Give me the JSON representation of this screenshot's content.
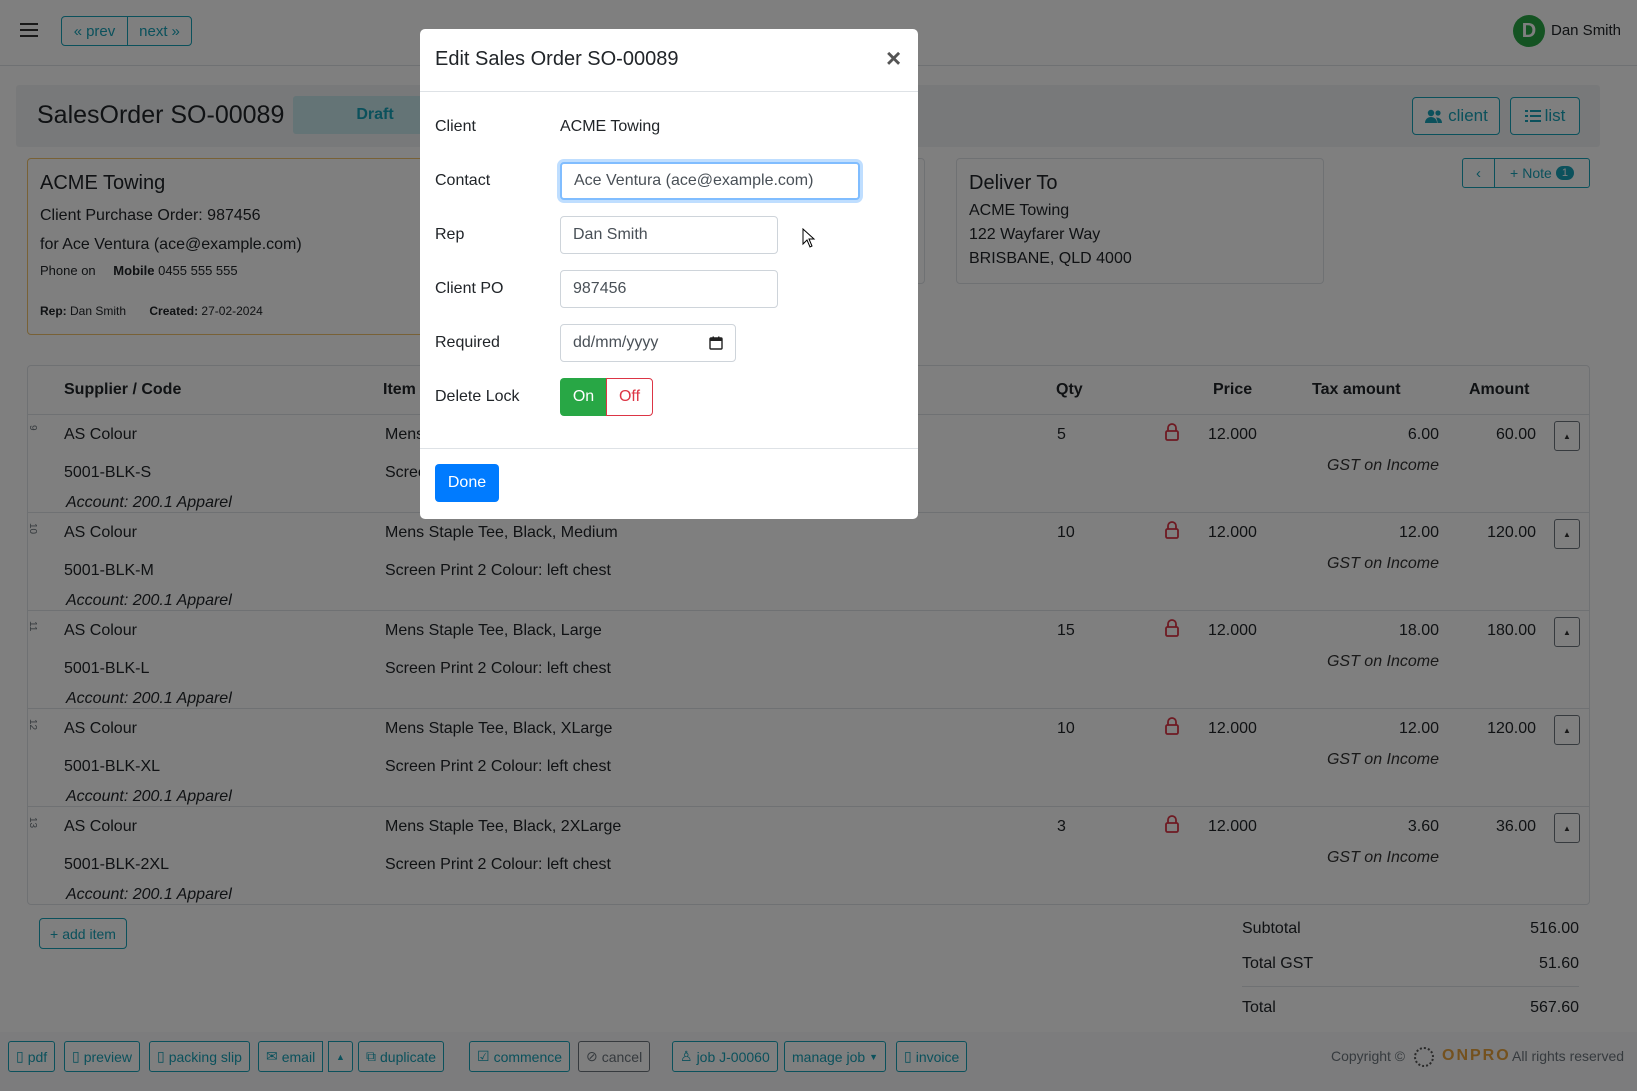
{
  "topbar": {
    "prev_label": "prev",
    "next_label": "next",
    "user_initial": "D",
    "user_name": "Dan Smith"
  },
  "header": {
    "title": "SalesOrder SO-00089",
    "status": "Draft",
    "client_button": "client",
    "list_button": "list"
  },
  "client_card": {
    "name": "ACME Towing",
    "po_line": "Client Purchase Order: 987456",
    "for_line": "for Ace Ventura (ace@example.com)",
    "phone_label": "Phone on",
    "mobile_label": "Mobile",
    "mobile_value": "0455 555 555",
    "rep_label": "Rep:",
    "rep_value": "Dan Smith",
    "created_label": "Created:",
    "created_value": "27-02-2024"
  },
  "deliver_card": {
    "title": "Deliver To",
    "line1": "ACME Towing",
    "line2": "122 Wayfarer Way",
    "line3": "BRISBANE, QLD 4000"
  },
  "note_button": {
    "label": "Note",
    "count": "1"
  },
  "table": {
    "headers": {
      "supplier": "Supplier / Code",
      "item": "Item",
      "qty": "Qty",
      "price": "Price",
      "tax": "Tax amount",
      "amount": "Amount"
    },
    "rows": [
      {
        "idx": "9",
        "supplier": "AS Colour",
        "code": "5001-BLK-S",
        "item": "Mens",
        "desc": "Scree",
        "account": "Account: 200.1 Apparel",
        "qty": "5",
        "price": "12.000",
        "tax": "6.00",
        "tax_note": "GST on Income",
        "amount": "60.00"
      },
      {
        "idx": "10",
        "supplier": "AS Colour",
        "code": "5001-BLK-M",
        "item": "Mens Staple Tee, Black, Medium",
        "desc": "Screen Print 2 Colour: left chest",
        "account": "Account: 200.1 Apparel",
        "qty": "10",
        "price": "12.000",
        "tax": "12.00",
        "tax_note": "GST on Income",
        "amount": "120.00"
      },
      {
        "idx": "11",
        "supplier": "AS Colour",
        "code": "5001-BLK-L",
        "item": "Mens Staple Tee, Black, Large",
        "desc": "Screen Print 2 Colour: left chest",
        "account": "Account: 200.1 Apparel",
        "qty": "15",
        "price": "12.000",
        "tax": "18.00",
        "tax_note": "GST on Income",
        "amount": "180.00"
      },
      {
        "idx": "12",
        "supplier": "AS Colour",
        "code": "5001-BLK-XL",
        "item": "Mens Staple Tee, Black, XLarge",
        "desc": "Screen Print 2 Colour: left chest",
        "account": "Account: 200.1 Apparel",
        "qty": "10",
        "price": "12.000",
        "tax": "12.00",
        "tax_note": "GST on Income",
        "amount": "120.00"
      },
      {
        "idx": "13",
        "supplier": "AS Colour",
        "code": "5001-BLK-2XL",
        "item": "Mens Staple Tee, Black, 2XLarge",
        "desc": "Screen Print 2 Colour: left chest",
        "account": "Account: 200.1 Apparel",
        "qty": "3",
        "price": "12.000",
        "tax": "3.60",
        "tax_note": "GST on Income",
        "amount": "36.00"
      }
    ]
  },
  "add_item_label": "add item",
  "totals": {
    "subtotal_label": "Subtotal",
    "subtotal": "516.00",
    "gst_label": "Total GST",
    "gst": "51.60",
    "total_label": "Total",
    "total": "567.60"
  },
  "bottom_bar": {
    "pdf": "pdf",
    "preview": "preview",
    "packing_slip": "packing slip",
    "email": "email",
    "duplicate": "duplicate",
    "commence": "commence",
    "cancel": "cancel",
    "job": "job J-00060",
    "manage_job": "manage job",
    "invoice": "invoice",
    "copyright": "Copyright ©",
    "brand": "ONPRO",
    "rights": "All rights reserved"
  },
  "modal": {
    "title": "Edit Sales Order SO-00089",
    "close": "×",
    "client_label": "Client",
    "client_value": "ACME Towing",
    "contact_label": "Contact",
    "contact_value": "Ace Ventura (ace@example.com)",
    "rep_label": "Rep",
    "rep_value": "Dan Smith",
    "po_label": "Client PO",
    "po_value": "987456",
    "required_label": "Required",
    "required_placeholder": "dd/mm/yyyy",
    "lock_label": "Delete Lock",
    "lock_on": "On",
    "lock_off": "Off",
    "done_label": "Done"
  },
  "colors": {
    "accent": "#17a2b8",
    "primary": "#007bff",
    "success": "#28a745",
    "danger": "#dc3545",
    "brand": "#e8a33c"
  }
}
